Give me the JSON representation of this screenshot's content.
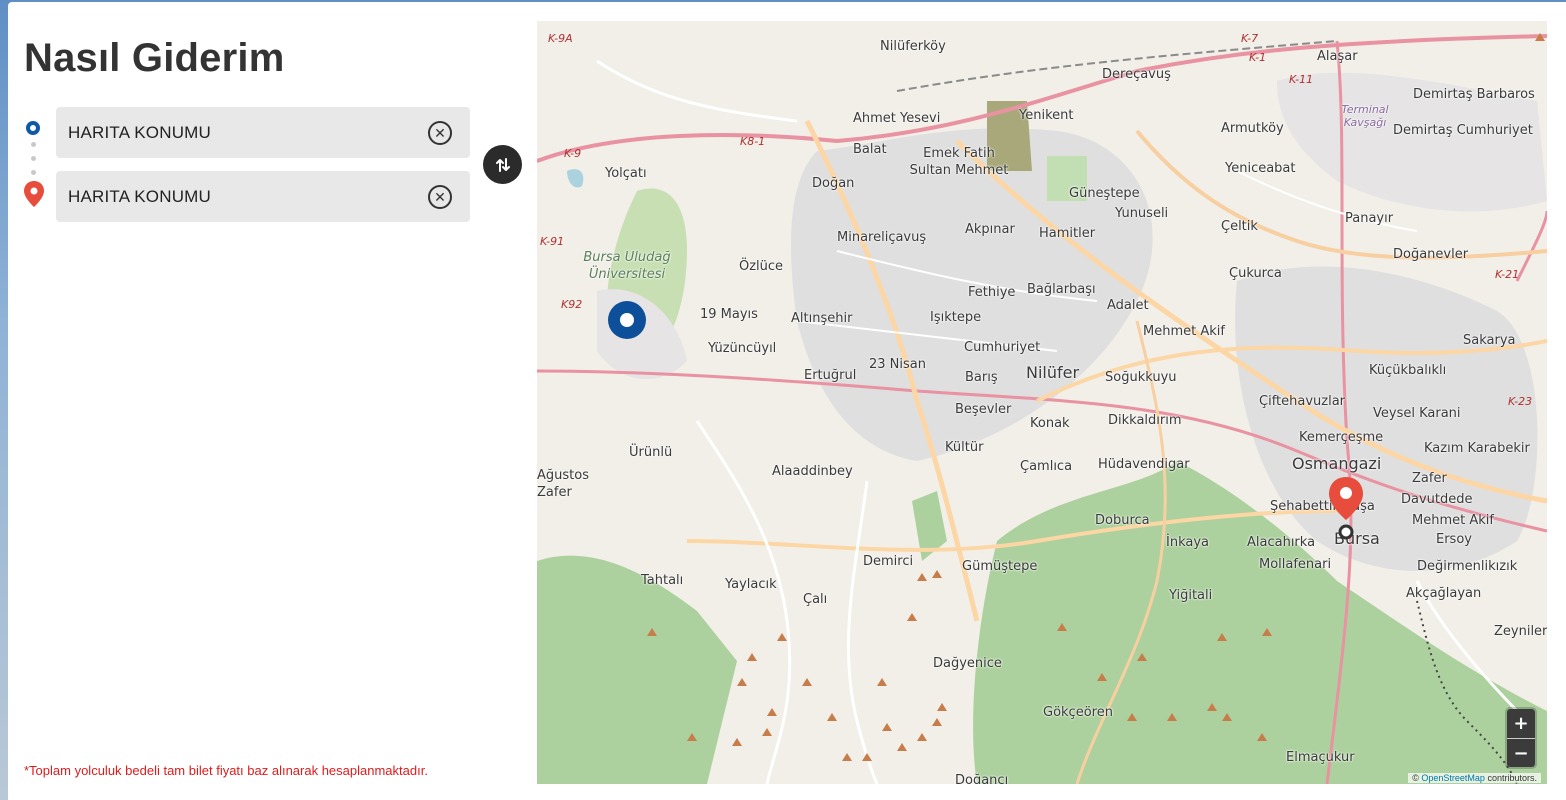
{
  "page": {
    "title": "Nasıl Giderim",
    "footnote": "*Toplam yolculuk bedeli tam bilet fiyatı baz alınarak hesaplanmaktadır."
  },
  "route": {
    "origin": {
      "value": "HARITA KONUMU",
      "icon": "origin-circle-icon",
      "color": "#0e5aa7"
    },
    "destination": {
      "value": "HARITA KONUMU",
      "icon": "map-pin-icon",
      "color": "#e74c3c"
    },
    "clear_icon": "circle-x-icon",
    "swap_icon": "swap-arrows-icon"
  },
  "map": {
    "labels": [
      "Nilüferköy",
      "Dereçavuş",
      "Alaşar",
      "Demirtaş Barbaros",
      "Terminal Kavşağı",
      "Demirtaş Cumhuriyet",
      "Ahmet Yesevi",
      "Yenikent",
      "Armutköy",
      "Balat",
      "Emek Fatih Sultan Mehmet",
      "Yolçatı",
      "Doğan",
      "Yeniceabat",
      "Güneştepe",
      "Yunuseli",
      "Çeltik",
      "Panayır",
      "Minareliçavuş",
      "Akpınar",
      "Hamitler",
      "Doğanevler",
      "Bursa Uludağ Üniversitesi",
      "Özlüce",
      "Çukurca",
      "Fethiye",
      "Bağlarbaşı",
      "Adalet",
      "Sakarya",
      "19 Mayıs",
      "Altınşehir",
      "Işıktepe",
      "Mehmet Akif",
      "Yüzüncüyıl",
      "Cumhuriyet",
      "Küçükbalıklı",
      "23 Nisan",
      "Ertuğrul",
      "Nilüfer",
      "Barış",
      "Soğukkuyu",
      "Çiftehavuzlar",
      "Beşevler",
      "Veysel Karani",
      "Dikkaldırım",
      "Konak",
      "Kemerçeşme",
      "Kazım Karabekir",
      "Kültür",
      "Osmangazi",
      "Zafer",
      "Ürünlü",
      "Alaaddinbey",
      "Çamlıca",
      "Hüdavendigar",
      "Şehabettin Paşa",
      "Davutdede",
      "Ağustos Zafer",
      "Doburca",
      "Mehmet Akif",
      "İnkaya",
      "Alacahırka",
      "Bursa",
      "Ersoy",
      "Demirci",
      "Mollafenari",
      "Değirmenlikızık",
      "Tahtalı",
      "Yaylacık",
      "Gümüştepe",
      "Akçağlayan",
      "Çalı",
      "Yiğitali",
      "Zeyniler",
      "Dağyenice",
      "Gökçeören",
      "Elmaçukur",
      "Doğancı"
    ],
    "road_codes": [
      "K-9A",
      "K-7",
      "K-1",
      "K-11",
      "K-9",
      "K8-1",
      "K-91",
      "K92",
      "K-21",
      "K-23"
    ],
    "zoom_in_label": "+",
    "zoom_out_label": "−",
    "attribution_prefix": "©",
    "attribution_link": "OpenStreetMap",
    "attribution_suffix": "contributors.",
    "colors": {
      "background": "#f2efe9",
      "forest": "#add19e",
      "residential": "#e0dfdf",
      "major_road": "#f7cfa0",
      "primary_road": "#fcd6a4",
      "motorway": "#e892a2",
      "origin_marker": "#0e4f9a",
      "destination_marker": "#e74c3c"
    }
  }
}
